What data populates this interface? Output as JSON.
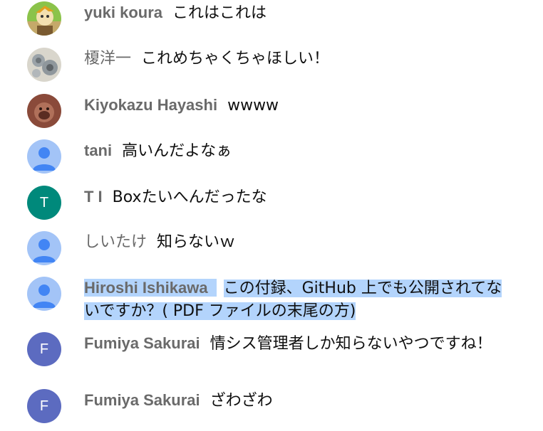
{
  "messages": [
    {
      "author": "yuki koura",
      "text": "これはこれは"
    },
    {
      "author": "榎洋一",
      "text": "これめちゃくちゃほしい！"
    },
    {
      "author": "Kiyokazu Hayashi",
      "text": "wwww"
    },
    {
      "author": "tani",
      "text": "高いんだよなぁ"
    },
    {
      "author": "T I",
      "avatar_letter": "T",
      "avatar_color": "#00897b",
      "text": "Boxたいへんだったな"
    },
    {
      "author": "しいたけ",
      "text": "知らないｗ"
    },
    {
      "author": "Hiroshi Ishikawa",
      "text": "この付録、GitHub 上でも公開されてないですか？( PDF ファイルの末尾の方)",
      "selected": true
    },
    {
      "author": "Fumiya Sakurai",
      "avatar_letter": "F",
      "avatar_color": "#5c6bc0",
      "text": "情シス管理者しか知らないやつですね！"
    },
    {
      "author": "Fumiya Sakurai",
      "avatar_letter": "F",
      "avatar_color": "#5c6bc0",
      "text": "ざわざわ"
    }
  ],
  "colors": {
    "selection": "#b3d4fc",
    "author": "#6a6a6a",
    "default_avatar_bg": "#a3c4f7",
    "default_avatar_fg": "#4285f4"
  }
}
